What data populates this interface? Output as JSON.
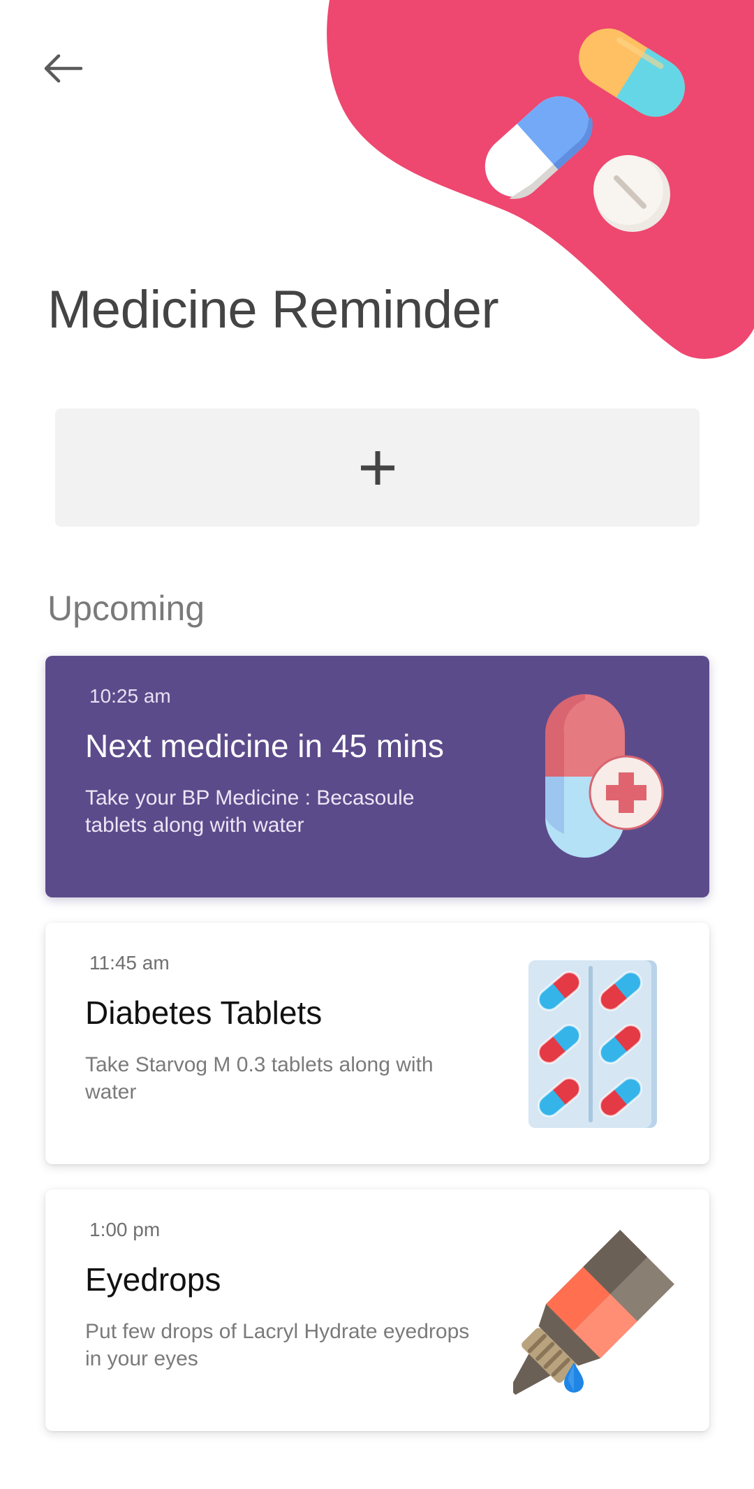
{
  "header": {
    "back_label": "←",
    "title": "Medicine Reminder"
  },
  "add_button": {
    "label": "+"
  },
  "upcoming": {
    "title": "Upcoming",
    "items": [
      {
        "time": "10:25 am",
        "heading": "Next medicine in 45 mins",
        "description": "Take your BP Medicine : Becasoule tablets along with water",
        "icon": "capsule-plus-icon",
        "highlighted": true
      },
      {
        "time": "11:45 am",
        "heading": "Diabetes Tablets",
        "description": "Take Starvog M 0.3 tablets along with water",
        "icon": "pill-blister-icon",
        "highlighted": false
      },
      {
        "time": "1:00 pm",
        "heading": "Eyedrops",
        "description": "Put few drops of Lacryl Hydrate eyedrops in your eyes",
        "icon": "eyedrop-bottle-icon",
        "highlighted": false
      }
    ]
  },
  "colors": {
    "accent_pink": "#ee4770",
    "card_highlight": "#5c4b8b",
    "add_button_bg": "#f2f2f2",
    "title_text": "#444444"
  }
}
